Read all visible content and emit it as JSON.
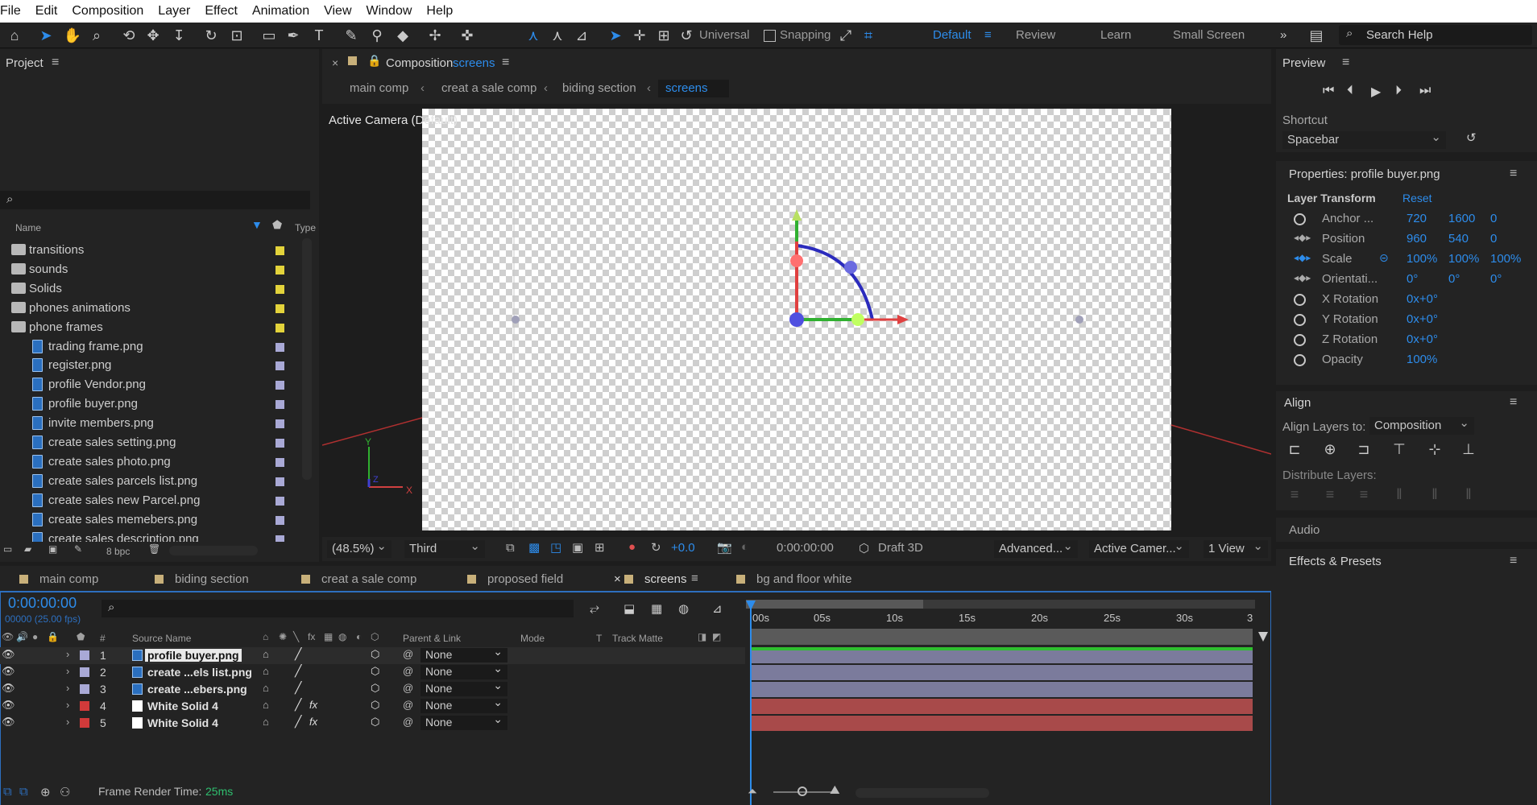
{
  "menu": [
    "File",
    "Edit",
    "Composition",
    "Layer",
    "Effect",
    "Animation",
    "View",
    "Window",
    "Help"
  ],
  "toolbar": {
    "universal_label": "Universal",
    "snapping_label": "Snapping",
    "workspaces": [
      "Default",
      "Review",
      "Learn",
      "Small Screen"
    ],
    "active_workspace": "Default",
    "search_placeholder": "Search Help"
  },
  "project": {
    "title": "Project",
    "columns": {
      "name": "Name",
      "type": "Type"
    },
    "items": [
      {
        "label": "transitions",
        "kind": "folder",
        "color": "#e3d33b"
      },
      {
        "label": "sounds",
        "kind": "folder",
        "color": "#e3d33b"
      },
      {
        "label": "Solids",
        "kind": "folder",
        "color": "#e3d33b"
      },
      {
        "label": "phones animations",
        "kind": "folder",
        "color": "#e3d33b"
      },
      {
        "label": "phone frames",
        "kind": "folder",
        "color": "#e3d33b"
      },
      {
        "label": "trading frame.png",
        "kind": "file",
        "color": "#a9a9d6"
      },
      {
        "label": "register.png",
        "kind": "file",
        "color": "#a9a9d6"
      },
      {
        "label": "profile Vendor.png",
        "kind": "file",
        "color": "#a9a9d6"
      },
      {
        "label": "profile buyer.png",
        "kind": "file",
        "color": "#a9a9d6"
      },
      {
        "label": "invite members.png",
        "kind": "file",
        "color": "#a9a9d6"
      },
      {
        "label": "create sales setting.png",
        "kind": "file",
        "color": "#a9a9d6"
      },
      {
        "label": "create sales photo.png",
        "kind": "file",
        "color": "#a9a9d6"
      },
      {
        "label": "create sales parcels list.png",
        "kind": "file",
        "color": "#a9a9d6"
      },
      {
        "label": "create sales new Parcel.png",
        "kind": "file",
        "color": "#a9a9d6"
      },
      {
        "label": "create sales memebers.png",
        "kind": "file",
        "color": "#a9a9d6"
      },
      {
        "label": "create sales description.png",
        "kind": "file",
        "color": "#a9a9d6"
      }
    ],
    "bpc": "8 bpc"
  },
  "composition": {
    "title_prefix": "Composition",
    "title_name": "screens",
    "breadcrumbs": [
      "main comp",
      "creat a sale comp",
      "biding section",
      "screens"
    ],
    "camera_label": "Active Camera (Default)",
    "zoom": "(48.5%)",
    "resolution": "Third",
    "exposure": "+0.0",
    "timecode": "0:00:00:00",
    "renderer": "Draft 3D",
    "advanced": "Advanced...",
    "camera": "Active Camer...",
    "views": "1 View"
  },
  "preview": {
    "title": "Preview",
    "shortcut_label": "Shortcut",
    "shortcut_value": "Spacebar"
  },
  "properties": {
    "title": "Properties: profile buyer.png",
    "section": "Layer Transform",
    "reset": "Reset",
    "rows": [
      {
        "name": "Anchor ...",
        "values": [
          "720",
          "1600",
          "0"
        ]
      },
      {
        "name": "Position",
        "values": [
          "960",
          "540",
          "0"
        ]
      },
      {
        "name": "Scale",
        "values": [
          "100%",
          "100%",
          "100%"
        ]
      },
      {
        "name": "Orientati...",
        "values": [
          "0°",
          "0°",
          "0°"
        ]
      },
      {
        "name": "X Rotation",
        "values": [
          "0x+0°"
        ]
      },
      {
        "name": "Y Rotation",
        "values": [
          "0x+0°"
        ]
      },
      {
        "name": "Z Rotation",
        "values": [
          "0x+0°"
        ]
      },
      {
        "name": "Opacity",
        "values": [
          "100%"
        ]
      }
    ]
  },
  "align": {
    "title": "Align",
    "align_to_label": "Align Layers to:",
    "align_to_value": "Composition",
    "distribute_label": "Distribute Layers:"
  },
  "audio": {
    "title": "Audio"
  },
  "effects": {
    "title": "Effects & Presets"
  },
  "timeline": {
    "tabs": [
      "main comp",
      "biding section",
      "creat a sale comp",
      "proposed field",
      "screens",
      "bg and floor white"
    ],
    "active_tab": "screens",
    "timecode": "0:00:00:00",
    "fps": "00000 (25.00 fps)",
    "headers": {
      "num": "#",
      "source": "Source Name",
      "parent": "Parent & Link",
      "mode": "Mode",
      "t": "T",
      "matte": "Track Matte"
    },
    "ruler": [
      "00s",
      "05s",
      "10s",
      "15s",
      "20s",
      "25s",
      "30s",
      "3"
    ],
    "layers": [
      {
        "num": "1",
        "name": "profile buyer.png",
        "color": "#a9a9d6",
        "parent": "None",
        "bar": "#7b7b9c",
        "fx": false,
        "solid": false
      },
      {
        "num": "2",
        "name": "create ...els list.png",
        "color": "#a9a9d6",
        "parent": "None",
        "bar": "#7b7b9c",
        "fx": false,
        "solid": false
      },
      {
        "num": "3",
        "name": "create ...ebers.png",
        "color": "#a9a9d6",
        "parent": "None",
        "bar": "#7b7b9c",
        "fx": false,
        "solid": false
      },
      {
        "num": "4",
        "name": "White Solid 4",
        "color": "#d13a3a",
        "parent": "None",
        "bar": "#a84a4a",
        "fx": true,
        "solid": true
      },
      {
        "num": "5",
        "name": "White Solid 4",
        "color": "#d13a3a",
        "parent": "None",
        "bar": "#a84a4a",
        "fx": true,
        "solid": true
      }
    ],
    "render_time_label": "Frame Render Time:",
    "render_time_value": "25ms"
  }
}
